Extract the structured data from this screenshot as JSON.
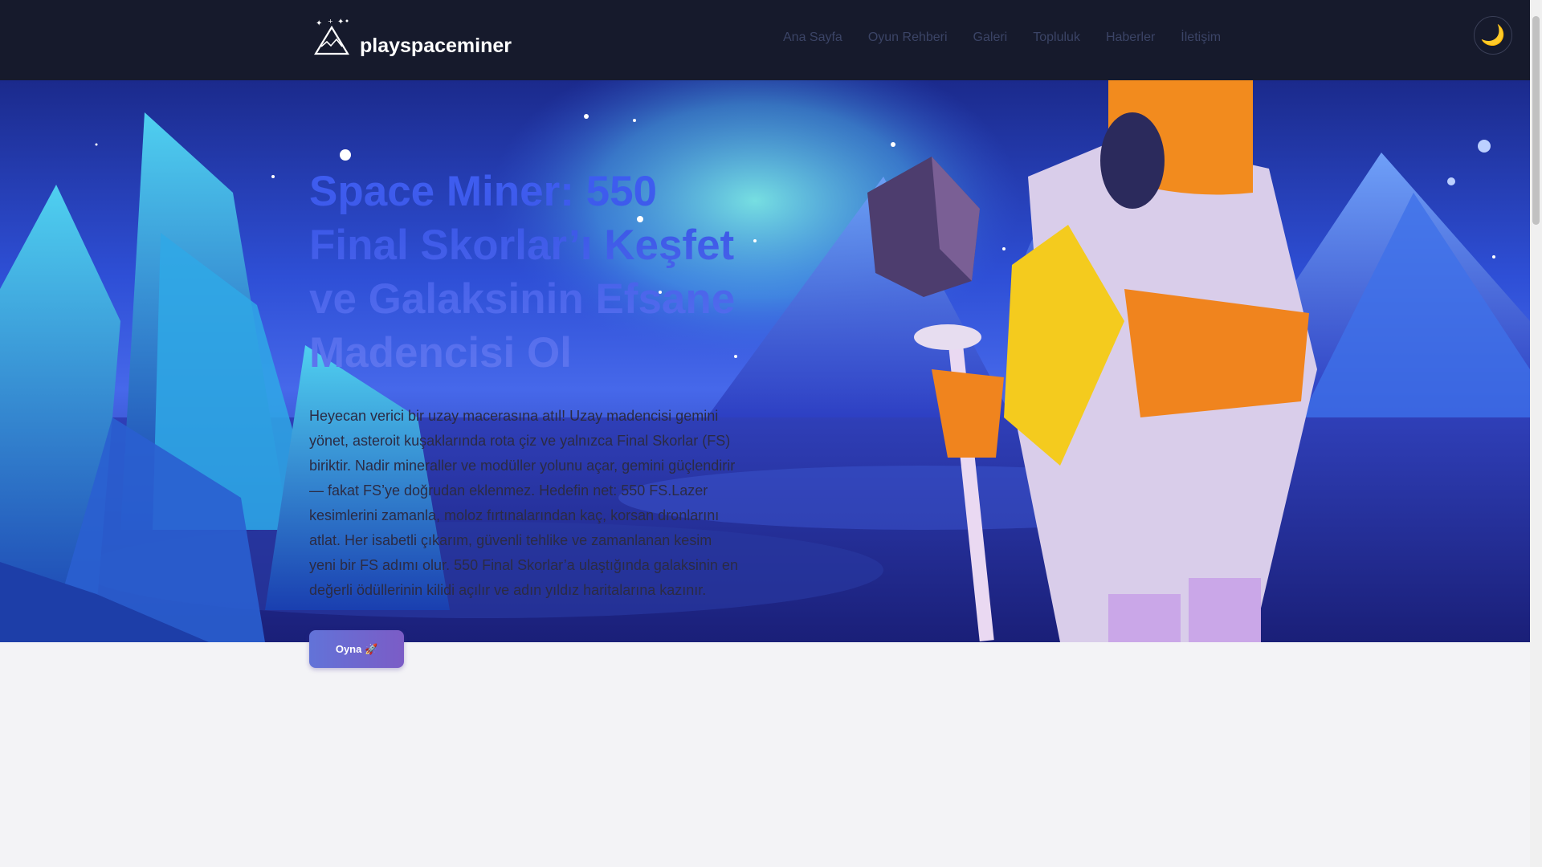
{
  "header": {
    "brand": "playspaceminer",
    "nav": [
      "Ana Sayfa",
      "Oyun Rehberi",
      "Galeri",
      "Topluluk",
      "Haberler",
      "İletişim"
    ],
    "theme_icon": "🌙"
  },
  "hero": {
    "title": "Space Miner: 550 Final Skorlar’ı Keşfet ve Galaksinin Efsane Madencisi Ol",
    "description": "Heyecan verici bir uzay macerasına atıl! Uzay madencisi gemini yönet, asteroit kuşaklarında rota çiz ve yalnızca Final Skorlar (FS) biriktir. Nadir mineraller ve modüller yolunu açar, gemini güçlendirir — fakat FS’ye doğrudan eklenmez. Hedefin net: 550 FS.Lazer kesimlerini zamanla, moloz fırtınalarından kaç, korsan dronlarını atlat. Her isabetli çıkarım, güvenli tehlike ve zamanlanan kesim yeni bir FS adımı olur. 550 Final Skorlar’a ulaştığında galaksinin en değerli ödüllerinin kilidi açılır ve adın yıldız haritalarına kazınır.",
    "cta": "Oyna 🚀"
  },
  "icons": {
    "logo": "mountain-stars-icon",
    "theme": "moon-icon"
  },
  "colors": {
    "header_bg": "#161a2c",
    "accent": "#3e5df2",
    "button_start": "#6273d8",
    "button_end": "#7b5cc6"
  }
}
